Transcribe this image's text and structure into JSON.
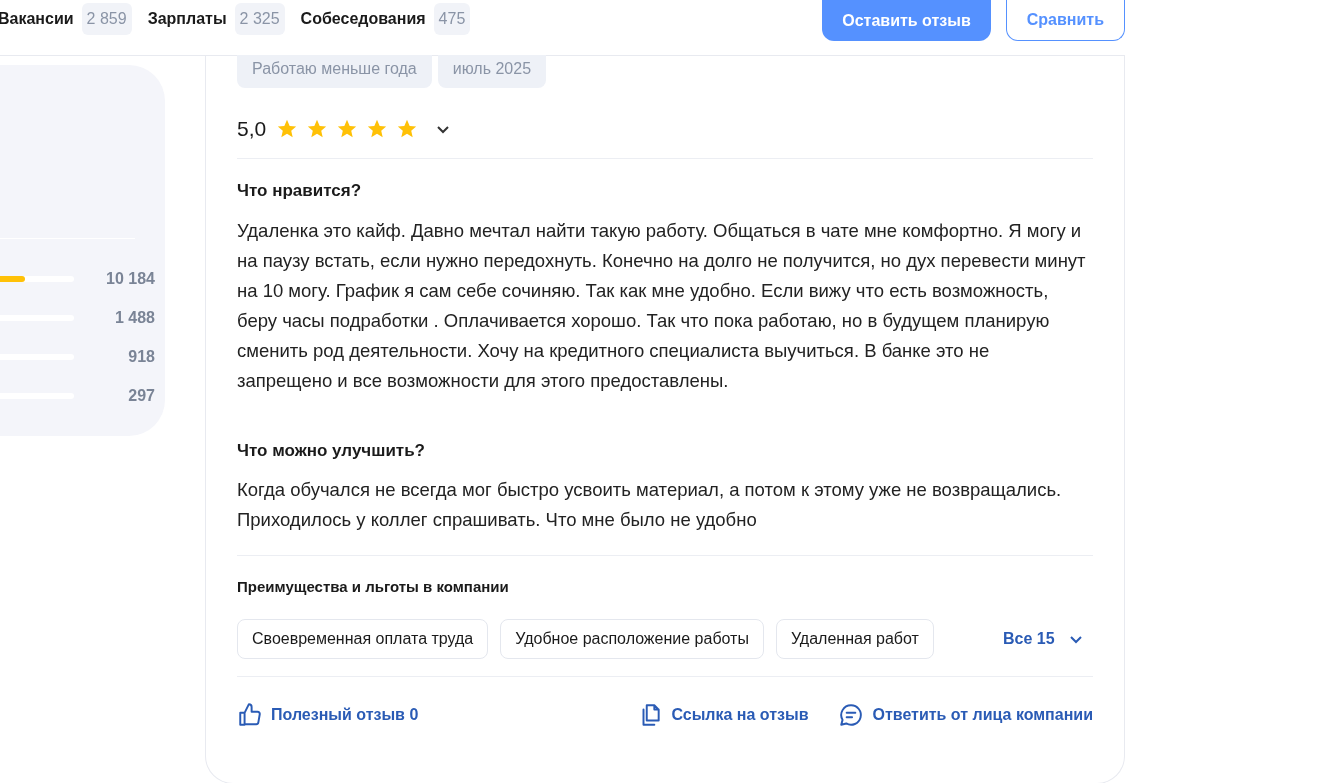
{
  "nav": {
    "tabs": [
      {
        "label": "Вакансии",
        "count": "2 859"
      },
      {
        "label": "Зарплаты",
        "count": "2 325"
      },
      {
        "label": "Собеседования",
        "count": "475"
      }
    ],
    "buttons": [
      {
        "label": "Оставить отзыв",
        "kind": "primary"
      },
      {
        "label": "Сравнить",
        "kind": "outline"
      }
    ]
  },
  "rating_panel": {
    "rows": [
      {
        "level": 0.34,
        "count": "10 184"
      },
      {
        "count": "1 488"
      },
      {
        "count": "918"
      },
      {
        "count": "297"
      }
    ]
  },
  "review": {
    "tags": [
      "Работаю меньше года",
      "июль 2025"
    ],
    "rating": "5,0",
    "stars": 5,
    "sections": [
      {
        "title": "Что нравится?",
        "text": "Удаленка это кайф. Давно мечтал найти такую работу. Общаться в чате мне комфортно. Я могу и на паузу встать, если нужно передохнуть. Конечно на долго не получится, но дух перевести минут на 10 могу. График я сам себе сочиняю. Так как мне удобно. Если вижу что есть возможность, беру часы подработки . Оплачивается хорошо. Так что пока работаю, но в будущем планирую сменить род деятельности. Хочу на кредитного специалиста выучиться. В банке это не запрещено и все возможности для этого предоставлены."
      },
      {
        "title": "Что можно улучшить?",
        "text": "Когда обучался не всегда мог быстро усвоить материал, а потом к этому уже не возвращались. Приходилось у коллег спрашивать. Что мне было не удобно"
      }
    ],
    "benefits": {
      "title": "Преимущества и льготы в компании",
      "items": [
        "Своевременная оплата труда",
        "Удобное расположение работы",
        "Удаленная работ"
      ],
      "more": "Все 15"
    },
    "actions": [
      {
        "kind": "like",
        "label": "Полезный отзыв 0"
      },
      {
        "kind": "link",
        "label": "Ссылка на отзыв"
      },
      {
        "kind": "reply",
        "label": "Ответить от лица компании"
      }
    ]
  }
}
